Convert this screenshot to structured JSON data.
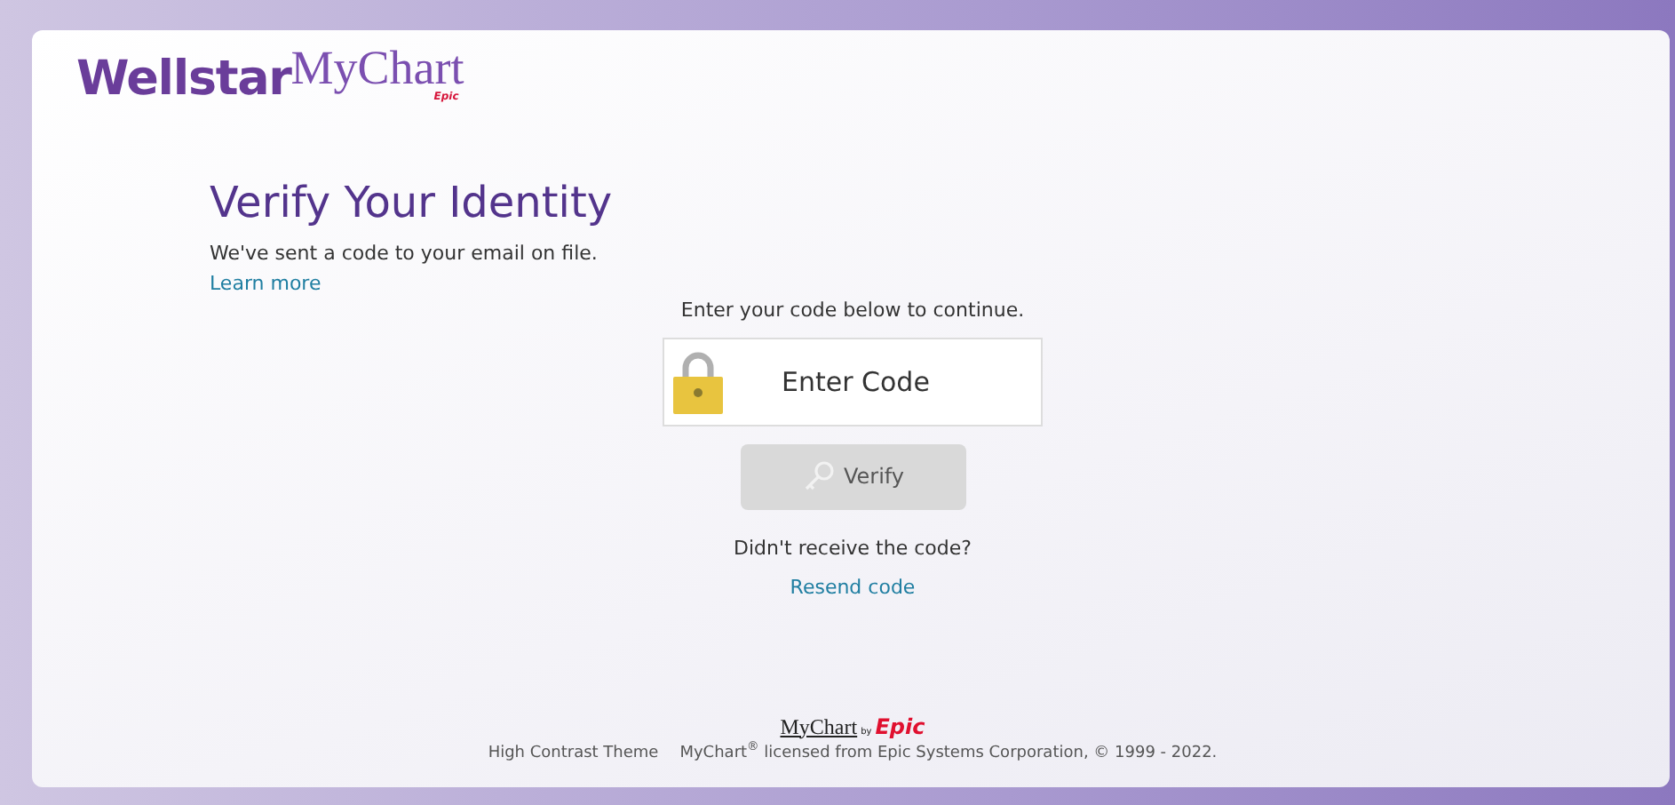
{
  "logo": {
    "brand": "Wellstar",
    "product": "MyChart",
    "maker": "Epic"
  },
  "heading": "Verify Your Identity",
  "message": "We've sent a code to your email on file.",
  "learn_more_link": "Learn more",
  "instruction": "Enter your code below to continue.",
  "code_field": {
    "placeholder": "Enter Code"
  },
  "verify_button": {
    "label": "Verify",
    "disabled": true
  },
  "resend_prompt": "Didn't receive the code?",
  "resend_link": "Resend code",
  "footer": {
    "logo": {
      "product": "MyChart",
      "by": "by",
      "maker": "Epic"
    },
    "theme_link": "High Contrast Theme",
    "copyright": "MyChart$^{®}$ licensed from Epic Systems Corporation, © 1999 - 2022."
  }
}
